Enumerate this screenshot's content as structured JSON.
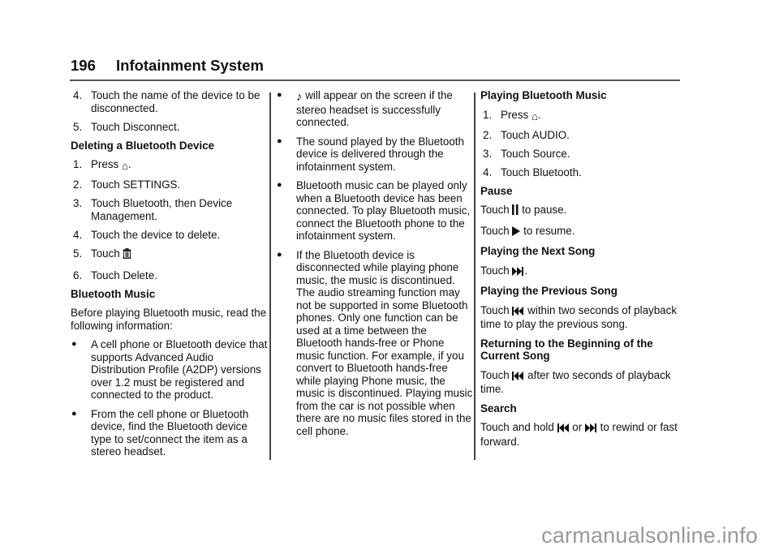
{
  "header": {
    "page_number": "196",
    "title": "Infotainment System"
  },
  "col1": {
    "disconnect_steps": [
      {
        "n": "4.",
        "text": "Touch the name of the device to be disconnected."
      },
      {
        "n": "5.",
        "text": "Touch Disconnect."
      }
    ],
    "delete_heading": "Deleting a Bluetooth Device",
    "delete_steps": [
      {
        "n": "1.",
        "pre": "Press ",
        "icon": "home-icon",
        "post": "."
      },
      {
        "n": "2.",
        "text": "Touch SETTINGS."
      },
      {
        "n": "3.",
        "text": "Touch Bluetooth, then Device Management."
      },
      {
        "n": "4.",
        "text": "Touch the device to delete."
      },
      {
        "n": "5.",
        "pre": "Touch ",
        "icon": "trash-icon",
        "post": ""
      },
      {
        "n": "6.",
        "text": "Touch Delete."
      }
    ],
    "music_heading": "Bluetooth Music",
    "music_intro": "Before playing Bluetooth music, read the following information:",
    "bullets": [
      "A cell phone or Bluetooth device that supports Advanced Audio Distribution Profile (A2DP) versions over 1.2 must be registered and connected to the product.",
      "From the cell phone or Bluetooth device, find the Bluetooth device type to set/connect the item as a stereo headset."
    ]
  },
  "col2": {
    "bullet_icon_text": "will appear on the screen if the stereo headset is successfully connected.",
    "bullets": [
      "The sound played by the Bluetooth device is delivered through the infotainment system.",
      "Bluetooth music can be played only when a Bluetooth device has been connected. To play Bluetooth music, connect the Bluetooth phone to the infotainment system.",
      "If the Bluetooth device is disconnected while playing phone music, the music is discontinued. The audio streaming function may not be supported in some Bluetooth phones. Only one function can be used at a time between the Bluetooth hands-free or Phone music function. For example, if you convert to Bluetooth hands-free while playing Phone music, the music is discontinued. Playing music from the car is not possible when there are no music files stored in the cell phone."
    ]
  },
  "col3": {
    "playing_heading": "Playing Bluetooth Music",
    "playing_steps": [
      {
        "n": "1.",
        "pre": "Press ",
        "post": "."
      },
      {
        "n": "2.",
        "text": "Touch AUDIO."
      },
      {
        "n": "3.",
        "text": "Touch Source."
      },
      {
        "n": "4.",
        "text": "Touch Bluetooth."
      }
    ],
    "pause_heading": "Pause",
    "pause_pre": "Touch ",
    "pause_post": " to pause.",
    "resume_pre": "Touch ",
    "resume_post": " to resume.",
    "next_heading": "Playing the Next Song",
    "next_pre": "Touch ",
    "next_post": ".",
    "prev_heading": "Playing the Previous Song",
    "prev_pre": "Touch ",
    "prev_post": " within two seconds of playback time to play the previous song.",
    "restart_heading": "Returning to the Beginning of the Current Song",
    "restart_pre": "Touch ",
    "restart_post": " after two seconds of playback time.",
    "search_heading": "Search",
    "search_pre": "Touch and hold ",
    "search_mid": " or ",
    "search_post": " to rewind or fast forward."
  },
  "icons": {
    "home": "⌂",
    "trash": "🗑",
    "note": "♪",
    "pause": "❙❙",
    "play": "▶",
    "next": "⏭",
    "prev": "⏮"
  },
  "watermark": "carmanualsonline.info"
}
